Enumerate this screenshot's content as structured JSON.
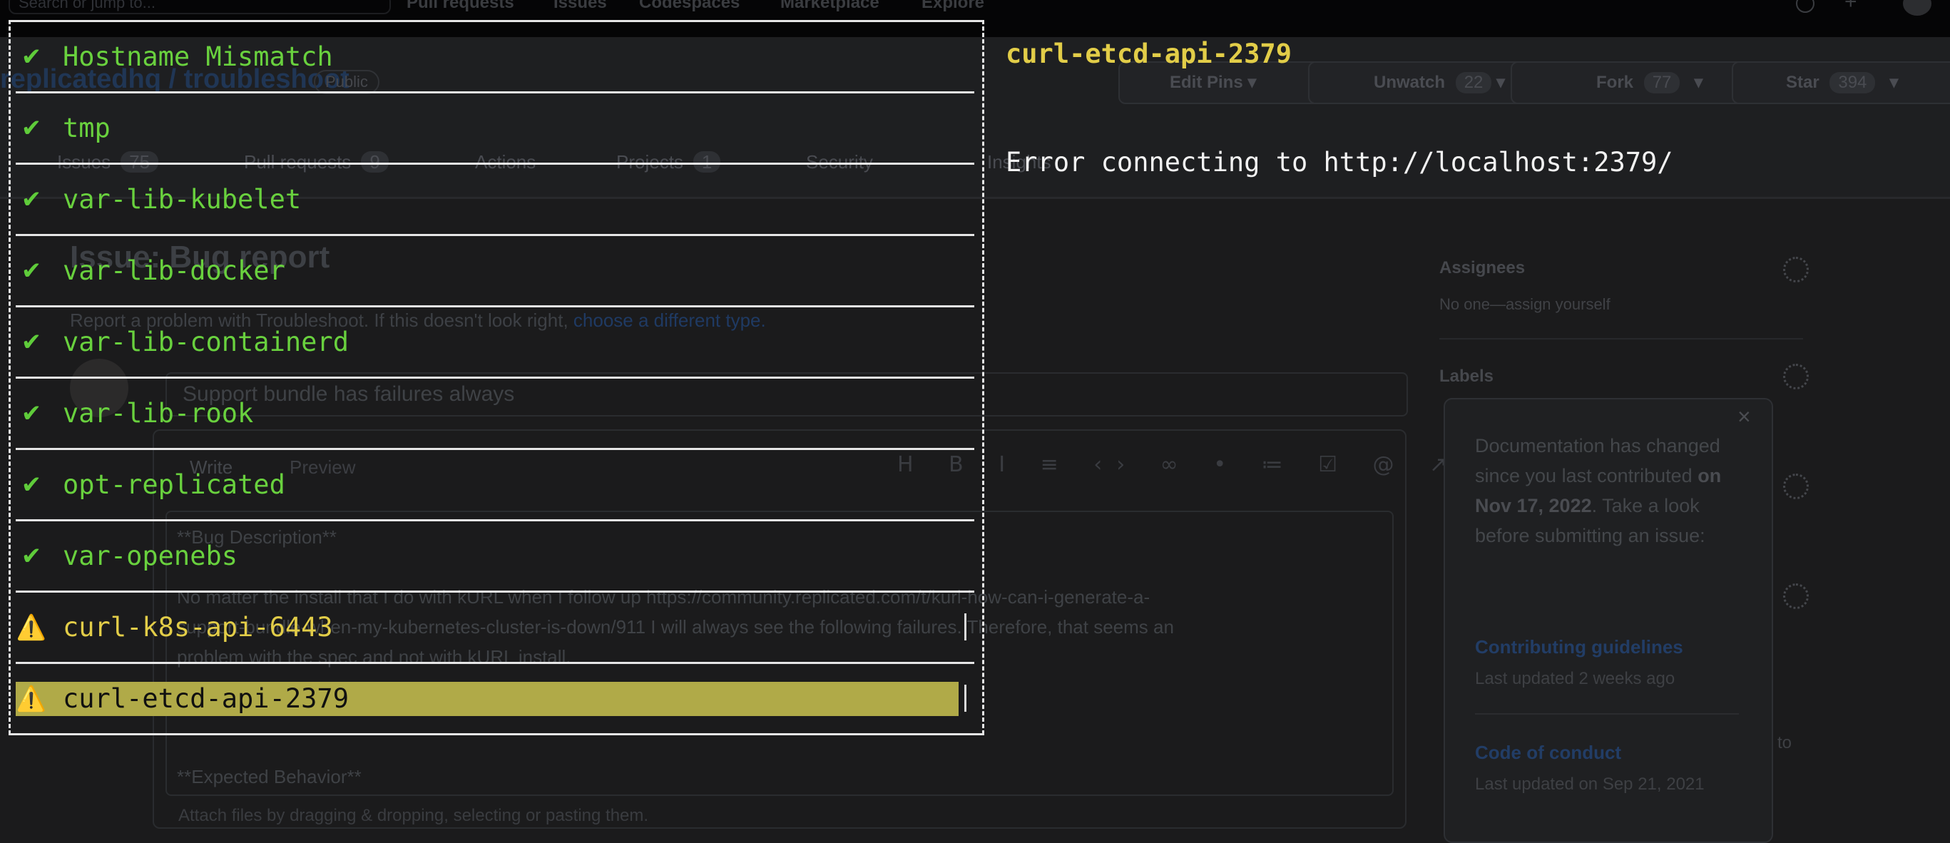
{
  "background_page": {
    "search_placeholder": "Search or jump to...",
    "nav": [
      "Pull requests",
      "Issues",
      "Codespaces",
      "Marketplace",
      "Explore"
    ],
    "repo_title": "replicatedhq / troubleshoot",
    "visibility": "Public",
    "buttons": {
      "edit_pins": "Edit Pins",
      "unwatch": "Unwatch",
      "unwatch_count": "22",
      "fork": "Fork",
      "fork_count": "77",
      "star": "Star",
      "star_count": "394"
    },
    "tabs": [
      {
        "label": "Issues",
        "count": "75"
      },
      {
        "label": "Pull requests",
        "count": "9"
      },
      {
        "label": "Actions",
        "count": ""
      },
      {
        "label": "Projects",
        "count": "1"
      },
      {
        "label": "Security",
        "count": ""
      },
      {
        "label": "Insights",
        "count": ""
      }
    ],
    "issue_heading": "Issue: Bug report",
    "issue_subtitle": "Report a problem with Troubleshoot. If this doesn't look right,",
    "issue_subtitle_link": "choose a different type.",
    "title_value": "Support bundle has failures always",
    "editor_tabs": {
      "write": "Write",
      "preview": "Preview"
    },
    "body_lines": [
      "**Bug Description**",
      "No matter the install that I do with kURL when I follow up https://community.replicated.com/t/kurl-how-can-i-generate-a-",
      "support-bundle-when-my-kubernetes-cluster-is-down/911 I will always see the following failures. Therefore, that seems an",
      "problem with the spec and not with kURL install.",
      "**Expected Behavior**"
    ],
    "attach_hint": "Attach files by dragging & dropping, selecting or pasting them.",
    "sidebar": {
      "assignees_label": "Assignees",
      "assignees_value": "No one—assign yourself",
      "labels_label": "Labels"
    },
    "popover": {
      "text_1": "Documentation has changed since you last contributed",
      "text_bold": "on Nov 17, 2022",
      "text_2": ". Take a look before submitting an issue:",
      "link_1": "Contributing guidelines",
      "date_1": "Last updated 2 weeks ago",
      "link_2": "Code of conduct",
      "date_2": "Last updated on Sep 21, 2021"
    },
    "side_fragment": "to"
  },
  "terminal": {
    "check_icon": "✔",
    "warn_icon": "⚠️",
    "items": [
      {
        "label": "Hostname Mismatch",
        "status": "pass"
      },
      {
        "label": "tmp",
        "status": "pass"
      },
      {
        "label": "var-lib-kubelet",
        "status": "pass"
      },
      {
        "label": "var-lib-docker",
        "status": "pass"
      },
      {
        "label": "var-lib-containerd",
        "status": "pass"
      },
      {
        "label": "var-lib-rook",
        "status": "pass"
      },
      {
        "label": "opt-replicated",
        "status": "pass"
      },
      {
        "label": "var-openebs",
        "status": "pass"
      },
      {
        "label": "curl-k8s-api-6443",
        "status": "warn"
      },
      {
        "label": "curl-etcd-api-2379",
        "status": "warn",
        "selected": true
      }
    ],
    "detail_title": "curl-etcd-api-2379",
    "detail_message": "Error connecting to http://localhost:2379/",
    "colors": {
      "pass": "#69d13e",
      "warn": "#e2cd48",
      "selected_bg": "#b0aa48",
      "border": "#e6e6e6"
    }
  }
}
